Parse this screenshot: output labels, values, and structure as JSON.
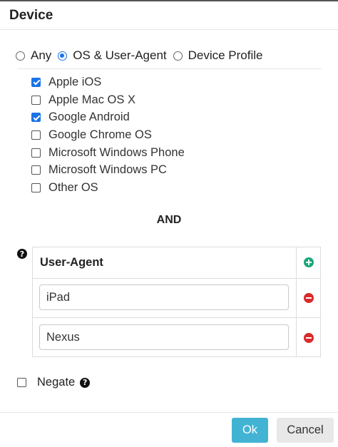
{
  "dialog": {
    "title": "Device"
  },
  "match_mode": {
    "options": [
      {
        "label": "Any",
        "selected": false
      },
      {
        "label": "OS & User-Agent",
        "selected": true
      },
      {
        "label": "Device Profile",
        "selected": false
      }
    ]
  },
  "os_list": [
    {
      "label": "Apple iOS",
      "checked": true
    },
    {
      "label": "Apple Mac OS X",
      "checked": false
    },
    {
      "label": "Google Android",
      "checked": true
    },
    {
      "label": "Google Chrome OS",
      "checked": false
    },
    {
      "label": "Microsoft Windows Phone",
      "checked": false
    },
    {
      "label": "Microsoft Windows PC",
      "checked": false
    },
    {
      "label": "Other OS",
      "checked": false
    }
  ],
  "and_label": "AND",
  "user_agent": {
    "header": "User-Agent",
    "entries": [
      "iPad",
      "Nexus"
    ],
    "add_icon": "plus-circle-icon",
    "remove_icon": "minus-circle-icon",
    "help_icon": "question-circle-icon"
  },
  "negate": {
    "label": "Negate",
    "checked": false,
    "help_icon": "question-circle-icon"
  },
  "footer": {
    "ok_label": "Ok",
    "cancel_label": "Cancel"
  },
  "colors": {
    "accent": "#1a73e8",
    "ok_button": "#43b3d3",
    "add": "#1aa67a",
    "remove": "#d92b2b",
    "cancel_button": "#e8e8e8"
  }
}
